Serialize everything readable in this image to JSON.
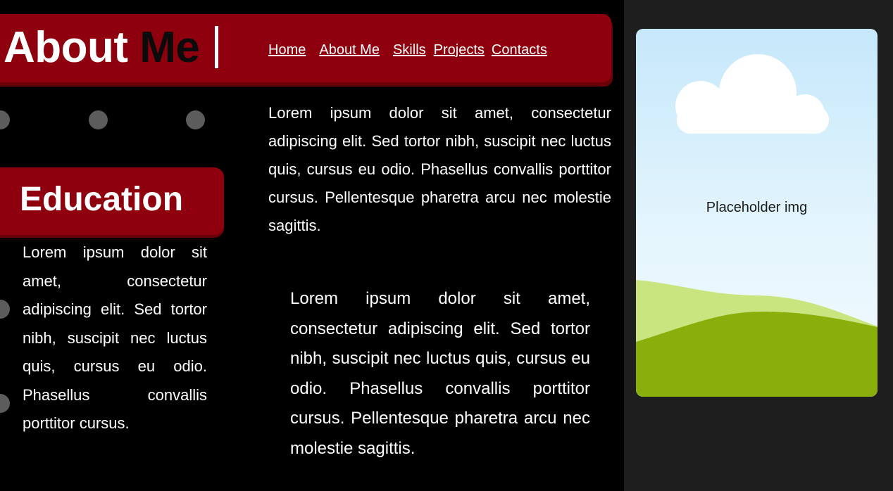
{
  "header": {
    "title_part1": "About ",
    "title_part2": "Me",
    "nav": [
      "Home",
      "About Me",
      "Skills",
      "Projects",
      "Contacts"
    ]
  },
  "education": {
    "heading": "Education",
    "text": "Lorem ipsum dolor sit amet, consectetur adipiscing elit. Sed tortor nibh, suscipit nec luctus quis, cursus eu odio. Phasellus convallis porttitor cursus."
  },
  "main": {
    "paragraph1": "Lorem ipsum dolor sit amet, consectetur adipiscing elit. Sed tortor nibh, suscipit nec luctus quis, cursus eu odio. Phasellus convallis porttitor cursus. Pellentesque pharetra arcu nec molestie sagittis.",
    "paragraph2": "Lorem ipsum dolor sit amet, consectetur adipiscing elit. Sed tortor nibh, suscipit nec luctus quis, cursus eu odio. Phasellus convallis porttitor cursus. Pellentesque pharetra arcu nec molestie sagittis."
  },
  "sidebar": {
    "image_label": "Placeholder img",
    "image_icon": "landscape-placeholder-icon"
  },
  "colors": {
    "accent": "#8e000d",
    "accent_dark": "#6a0008",
    "background": "#000000",
    "sidebar": "#1f1e1f",
    "dot": "#5c5c5c"
  }
}
